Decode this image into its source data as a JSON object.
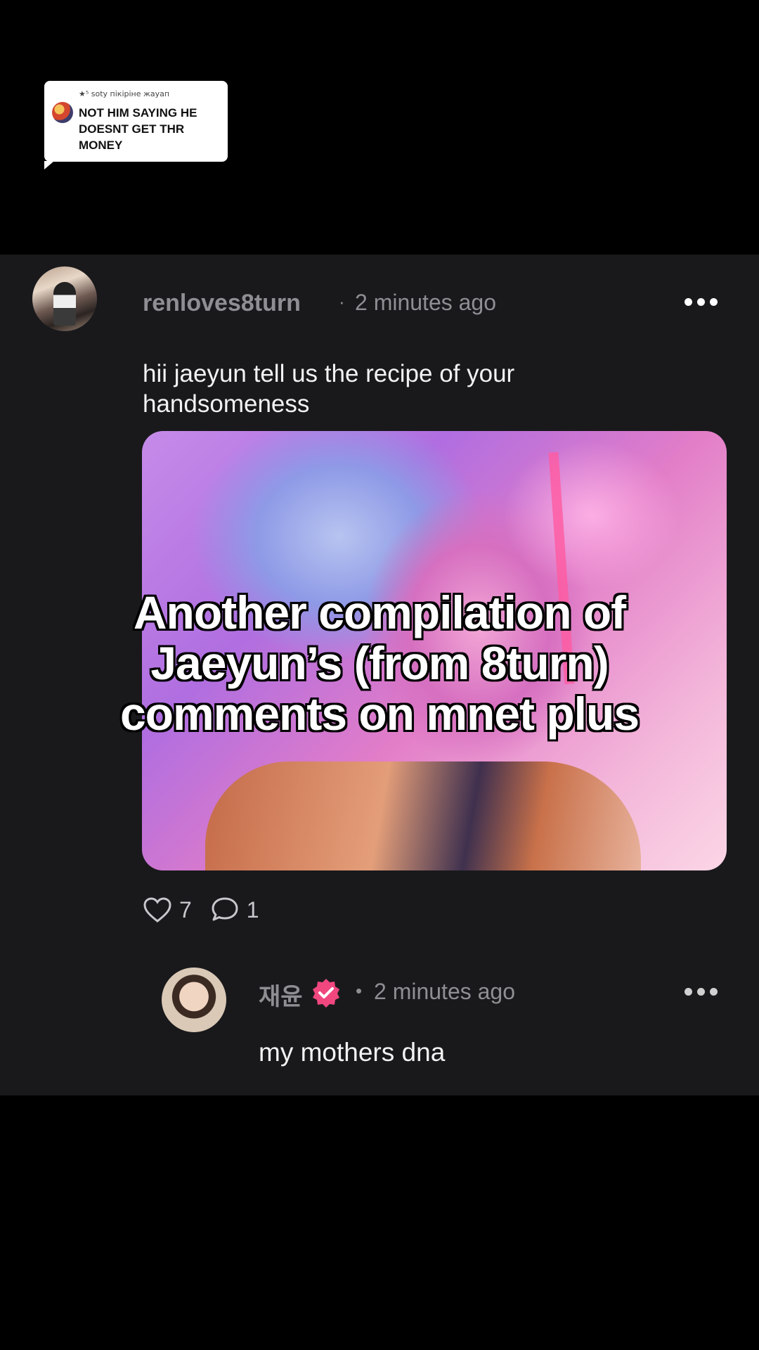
{
  "reply_sticker": {
    "header": "★⁵ soty пікіріне жауап",
    "text": "NOT HIM SAYING HE DOESNT GET THR MONEY"
  },
  "post": {
    "username": "renloves8turn",
    "separator": "·",
    "timestamp": "2 minutes ago",
    "body": "hii jaeyun tell us the recipe of your handsomeness",
    "like_count": "7",
    "comment_count": "1"
  },
  "overlay_caption": [
    "Another compilation of",
    "Jaeyun’s (from 8turn)",
    "comments on mnet plus"
  ],
  "reply": {
    "username": "재윤",
    "separator": "•",
    "timestamp": "2 minutes ago",
    "body": "my mothers dna"
  },
  "colors": {
    "card_bg": "#19191c",
    "muted_text": "#8e8e93",
    "verified_pink": "#f0477f"
  },
  "icons": [
    "more-icon",
    "heart-icon",
    "comment-icon",
    "verified-badge-icon"
  ]
}
